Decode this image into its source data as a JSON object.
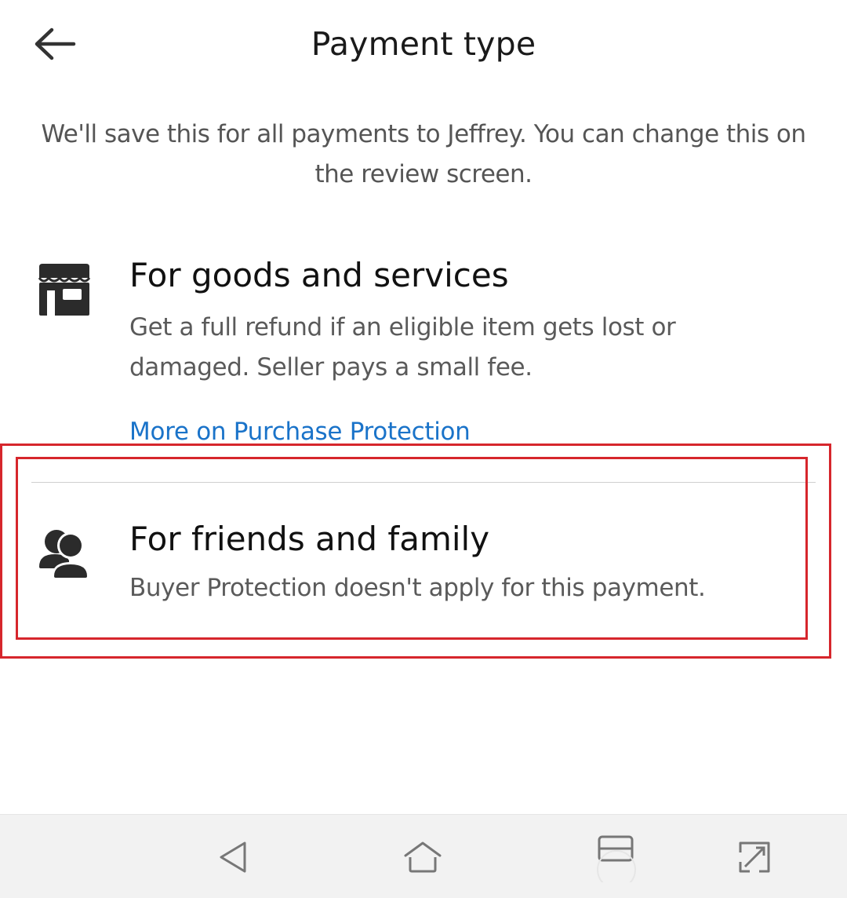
{
  "header": {
    "title": "Payment type",
    "back_icon": "arrow-left-icon"
  },
  "intro_text": "We'll save this for all payments to Jeffrey. You can change this on the review screen.",
  "options": [
    {
      "icon": "storefront-icon",
      "title": "For goods and services",
      "description": "Get a full refund if an eligible item gets lost or damaged. Seller pays a small fee.",
      "link": "More on Purchase Protection"
    },
    {
      "icon": "people-icon",
      "title": "For friends and family",
      "description": "Buyer Protection doesn't apply for this payment.",
      "highlighted": true
    }
  ],
  "system_nav": {
    "buttons": [
      "back-triangle-icon",
      "home-icon",
      "recents-icon",
      "expand-icon"
    ]
  },
  "colors": {
    "link": "#1a73c9",
    "highlight": "#d6262c",
    "text_primary": "#111111",
    "text_secondary": "#5a5a5a"
  }
}
